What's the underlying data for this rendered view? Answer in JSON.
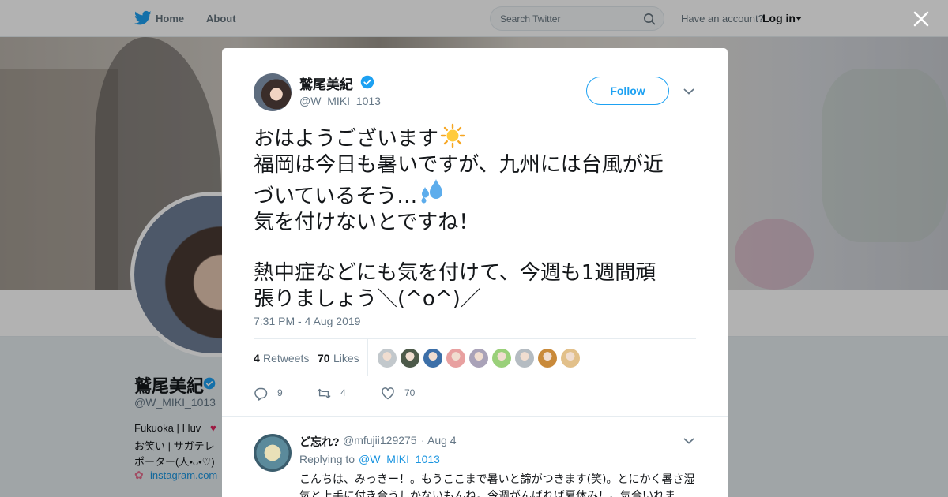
{
  "nav": {
    "home": "Home",
    "about": "About",
    "search_placeholder": "Search Twitter",
    "have_account": "Have an account?",
    "login": "Log in"
  },
  "profile": {
    "name": "鷲尾美紀",
    "handle": "@W_MIKI_1013",
    "bio_line1": "Fukuoka | I luv",
    "bio_line2": "お笑い | サガテレ",
    "bio_line3": "ポーター(人•ᴗ•♡)",
    "link": "instagram.com"
  },
  "tweet": {
    "author_name": "鷲尾美紀",
    "author_handle": "@W_MIKI_1013",
    "follow_label": "Follow",
    "text_lines": [
      "おはようございます",
      "福岡は今日も暑いですが、九州には台風が近",
      "づいているそう…",
      "気を付けないとですね！",
      "熱中症などにも気を付けて、今週も1週間頑",
      "張りましょう＼(^o^)／"
    ],
    "timestamp": "7:31 PM - 4 Aug 2019",
    "retweets_count": "4",
    "retweets_label": "Retweets",
    "likes_count": "70",
    "likes_label": "Likes",
    "likers": [
      "#c2c8cc",
      "#4d5a4a",
      "#3c6fa8",
      "#e8a0a0",
      "#a9a2b8",
      "#9ad07a",
      "#b5bcc2",
      "#c98a3a",
      "#e2c08a"
    ],
    "actions": {
      "replies": "9",
      "retweets": "4",
      "likes": "70"
    }
  },
  "reply": {
    "name": "ど忘れ?",
    "handle": "@mfujii129275",
    "dot": "·",
    "date": "Aug 4",
    "replying_label": "Replying to",
    "replying_to": "@W_MIKI_1013",
    "text": "こんちは、みっきー！。もうここまで暑いと諦がつきます(笑)。とにかく暑さ湿気と上手に付き合うしかないもんね。今週がんばれば夏休み！。気合いれま"
  },
  "colors": {
    "accent": "#1da1f2",
    "text": "#14171a",
    "muted": "#657786"
  }
}
